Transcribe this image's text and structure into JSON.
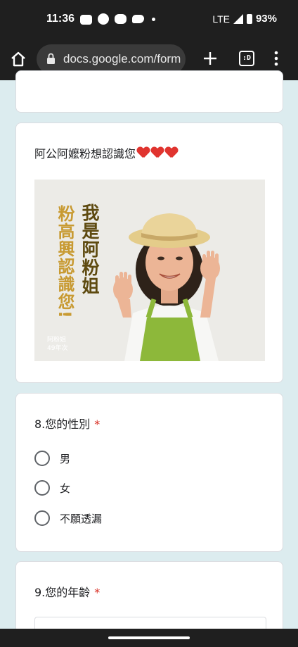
{
  "status": {
    "time": "11:36",
    "network": "LTE",
    "battery": "93%",
    "app_icons": [
      "discord-icon",
      "facebook-icon",
      "line-icon",
      "twitter-icon"
    ]
  },
  "browser": {
    "url": "docs.google.com/form",
    "tab_count_label": ":D"
  },
  "form": {
    "intro": {
      "title": "阿公阿嬤粉想認識您",
      "hearts": 3,
      "image": {
        "text_main": "我是阿粉姐",
        "text_sub": "粉高興認識您!",
        "caption": "阿粉姐\n49年次"
      }
    },
    "q8": {
      "title": "8.您的性別",
      "required_mark": "*",
      "options": [
        "男",
        "女",
        "不願透漏"
      ]
    },
    "q9": {
      "title": "9.您的年齡",
      "required_mark": "*"
    }
  },
  "colors": {
    "page_bg": "#dcecef",
    "required": "#d93025",
    "heart": "#e0342f",
    "apron": "#8db83a"
  }
}
